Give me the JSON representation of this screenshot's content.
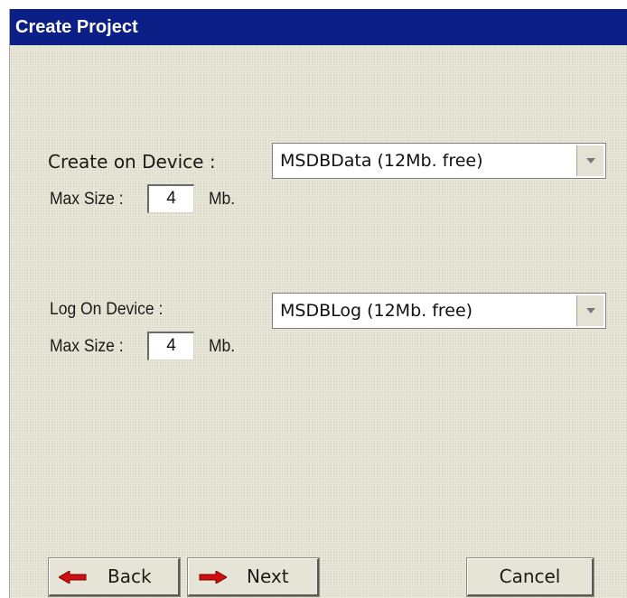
{
  "window": {
    "title": "Create Project"
  },
  "data_device": {
    "label": "Create on Device :",
    "selected": "MSDBData (12Mb. free)",
    "max_size_label": "Max Size :",
    "max_size_value": "4",
    "unit": "Mb."
  },
  "log_device": {
    "label": "Log On Device :",
    "selected": "MSDBLog (12Mb. free)",
    "max_size_label": "Max Size :",
    "max_size_value": "4",
    "unit": "Mb."
  },
  "buttons": {
    "back_label": "Back",
    "next_label": "Next",
    "cancel_label": "Cancel"
  },
  "icons": {
    "back": "left-arrow-icon",
    "next": "right-arrow-icon",
    "dropdown": "chevron-down-icon"
  },
  "colors": {
    "title_bar": "#0c1f86",
    "arrow_red": "#d01010"
  }
}
